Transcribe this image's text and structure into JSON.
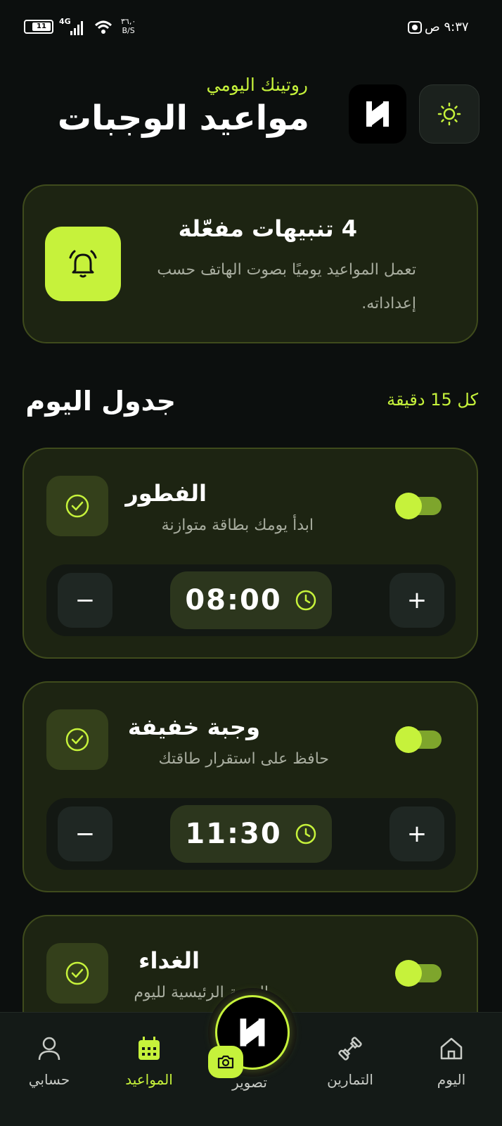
{
  "status_bar": {
    "time": "٩:٣٧ ص",
    "battery": "11",
    "network": "4G",
    "speed": "٣٦,٠",
    "speed_unit": "B/S"
  },
  "header": {
    "subtitle": "روتينك اليومي",
    "title": "مواعيد الوجبات"
  },
  "alerts_card": {
    "title": "4 تنبيهات مفعّلة",
    "description": "تعمل المواعيد يوميًا بصوت الهاتف حسب إعداداته."
  },
  "schedule": {
    "title": "جدول اليوم",
    "interval": "كل 15 دقيقة"
  },
  "meals": [
    {
      "name": "الفطور",
      "description": "ابدأ يومك بطاقة متوازنة",
      "time": "08:00",
      "enabled": true
    },
    {
      "name": "وجبة خفيفة",
      "description": "حافظ على استقرار طاقتك",
      "time": "11:30",
      "enabled": true
    },
    {
      "name": "الغداء",
      "description": "الوجبة الرئيسية لليوم",
      "time": "",
      "enabled": true
    }
  ],
  "controls": {
    "minus": "−",
    "plus": "+"
  },
  "nav": {
    "home": "اليوم",
    "workouts": "التمارين",
    "capture": "تصوير",
    "schedule": "المواعيد",
    "account": "حسابي"
  },
  "colors": {
    "accent": "#c6f23b",
    "background": "#0c0f0e",
    "card": "#1d2412"
  }
}
